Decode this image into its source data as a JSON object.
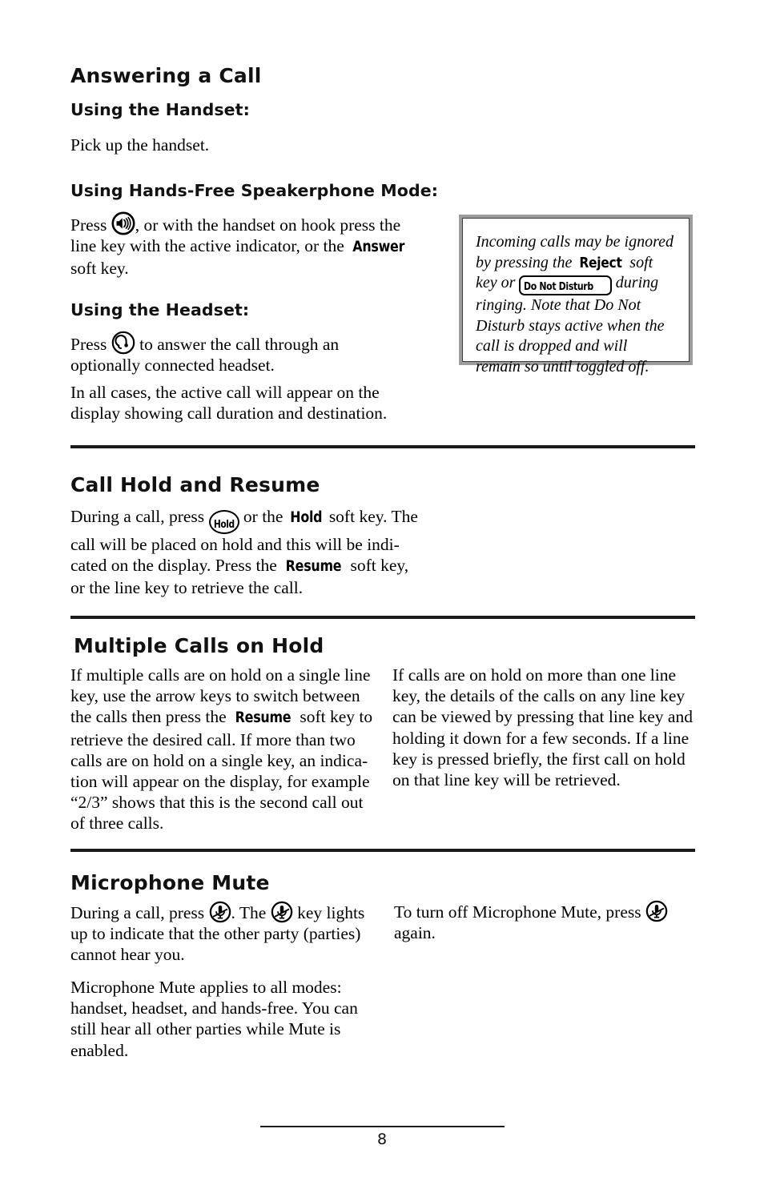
{
  "document": {
    "page_number": "8"
  },
  "sections": {
    "answering": {
      "heading": "Answering a Call",
      "handset": {
        "heading": "Using the Handset:",
        "body": "Pick up the handset."
      },
      "speakerphone": {
        "heading": "Using Hands-Free Speakerphone Mode:",
        "text_before_icon": "Press ",
        "icon": "speakerphone-icon",
        "text_after_icon": ", or with the handset on hook press the line key with the active indicator, or the ",
        "soft_key": "Answer",
        "text_end": " soft key."
      },
      "headset": {
        "heading": "Using the Headset:",
        "text_before_icon": "Press ",
        "icon": "headset-icon",
        "text_after_icon": " to answer the call through an optionally connected headset."
      },
      "closing": "In all cases, the active call will appear on the display showing call duration and destination."
    },
    "note": {
      "part1": "Incoming calls may be ignored by pressing the ",
      "soft_key": "Reject",
      "part2": " soft key or ",
      "key_label": "Do Not Disturb",
      "part3": " during ringing.  Note that Do Not Disturb stays active when the call is dropped and will remain so until toggled off."
    },
    "call_hold": {
      "heading": "Call Hold and Resume",
      "text_before_icon": "During a call, press ",
      "icon_label": "Hold",
      "text_after_icon": " or the ",
      "soft_key_hold": "Hold",
      "text_mid": " soft key.  The call will be placed on hold and this will be indi-cated on the display.  Press the ",
      "soft_key_resume": "Resume",
      "text_end": " soft key, or the line key to retrieve the call."
    },
    "multiple_calls": {
      "heading": "Multiple Calls on Hold",
      "left_part1": "If multiple calls are on hold on a single line key, use the arrow keys to switch between the calls then press the ",
      "left_soft_key": "Resume",
      "left_part2": " soft key to retrieve the desired call.  If more than two calls are on hold on a single key, an indica-tion will appear on the display, for example “2/3” shows that this is the second call out of three calls.",
      "right": "If calls are on hold on more than one line key, the details of the calls on any line key can be viewed by pressing that line key and holding it down for a few seconds.  If a line key is pressed briefly, the first call on hold on that line key will be retrieved."
    },
    "microphone_mute": {
      "heading": "Microphone Mute",
      "left_part1": "During a call, press ",
      "icon": "mute-icon",
      "left_part2": ".  The ",
      "left_part3": " key lights up to indicate that the other party (parties) cannot hear you.",
      "left_paragraph2": "Microphone Mute applies to all modes: handset, headset, and hands-free.  You can still hear all other parties while Mute is enabled.",
      "right_part1": "To turn off Microphone Mute, press ",
      "right_part2": " again."
    }
  },
  "colors": {
    "text": "#000000",
    "rule": "#1a1a1a",
    "note_border": "#9c9c9c",
    "page_background": "#ffffff"
  }
}
